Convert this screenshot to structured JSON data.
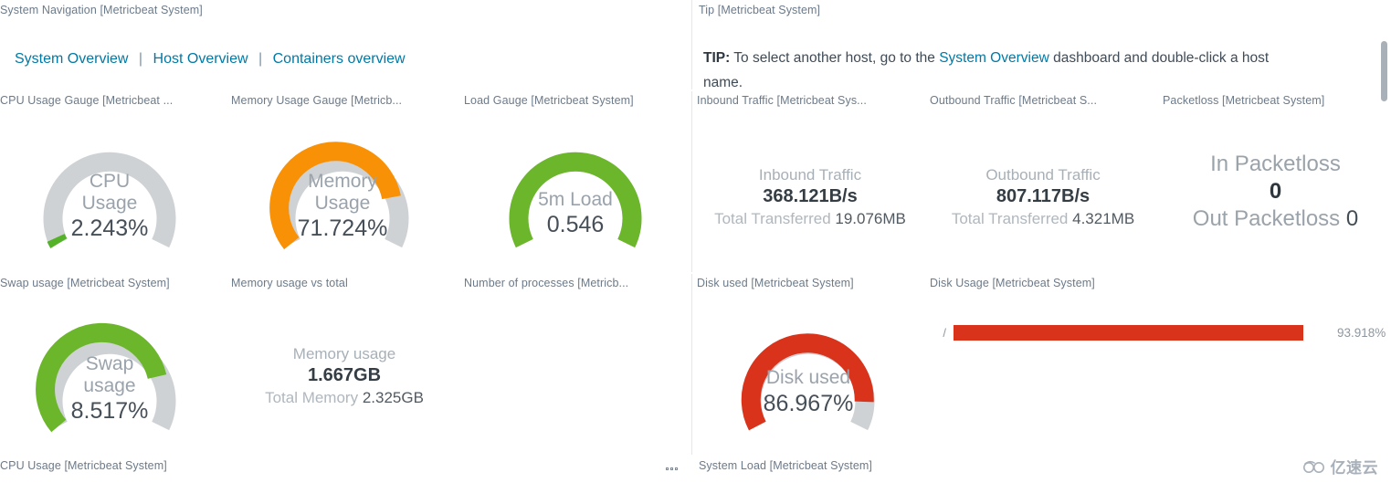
{
  "nav": {
    "panel_title": "System Navigation [Metricbeat System]",
    "links": [
      {
        "label": "System Overview"
      },
      {
        "label": "Host Overview"
      },
      {
        "label": "Containers overview"
      }
    ],
    "separator": "|"
  },
  "tip": {
    "panel_title": "Tip [Metricbeat System]",
    "prefix": "TIP:",
    "text_before": " To select another host, go to the ",
    "link": "System Overview",
    "text_after": " dashboard and double-click a host",
    "clipped_line": "name."
  },
  "row1": {
    "titles": [
      "CPU Usage Gauge [Metricbeat ...",
      "Memory Usage Gauge [Metricb...",
      "Load Gauge [Metricbeat System]",
      "Inbound Traffic [Metricbeat Sys...",
      "Outbound Traffic [Metricbeat S...",
      "Packetloss [Metricbeat System]"
    ]
  },
  "row2": {
    "titles": [
      "Swap usage [Metricbeat System]",
      "Memory usage vs total",
      "Number of processes [Metricb...",
      "Disk used [Metricbeat System]",
      "Disk Usage [Metricbeat System]"
    ]
  },
  "row3": {
    "titles": [
      "CPU Usage [Metricbeat System]",
      "System Load [Metricbeat System]"
    ]
  },
  "gauges": {
    "cpu": {
      "label_line1": "CPU",
      "label_line2": "Usage",
      "value": "2.243%",
      "percent": 2.243,
      "color": "#53b227"
    },
    "memory": {
      "label_line1": "Memory",
      "label_line2": "Usage",
      "value": "71.724%",
      "percent": 71.724,
      "color": "#f99106"
    },
    "load": {
      "label_line1": "5m Load",
      "label_line2": "",
      "value": "0.546",
      "percent": 100,
      "color": "#6cb62b"
    },
    "swap": {
      "label_line1": "Swap",
      "label_line2": "usage",
      "value": "8.517%",
      "percent": 71.0,
      "color": "#6cb62b"
    },
    "disk": {
      "label_line1": "Disk used",
      "label_line2": "",
      "value": "86.967%",
      "percent": 87.0,
      "color": "#d9331b"
    }
  },
  "metrics": {
    "inbound": {
      "title": "Inbound Traffic",
      "value": "368.121B/s",
      "foot_label": "Total Transferred",
      "foot_value": "19.076MB"
    },
    "outbound": {
      "title": "Outbound Traffic",
      "value": "807.117B/s",
      "foot_label": "Total Transferred",
      "foot_value": "4.321MB"
    },
    "memory_total": {
      "title": "Memory usage",
      "value": "1.667GB",
      "foot_label": "Total Memory",
      "foot_value": "2.325GB"
    },
    "packetloss": {
      "in_label": "In Packetloss",
      "in_value": "0",
      "out_label": "Out Packetloss",
      "out_value": "0"
    }
  },
  "disk_usage_bar": {
    "mount": "/",
    "value_label": "93.918%",
    "percent": 93.918,
    "color": "#d9331b"
  },
  "watermark": {
    "text": "亿速云"
  },
  "chart_data": {
    "type": "bar",
    "title": "Disk Usage [Metricbeat System]",
    "categories": [
      "/"
    ],
    "values": [
      93.918
    ],
    "xlabel": "",
    "ylabel": "",
    "xlim": [
      0,
      100
    ],
    "grid": false,
    "legend": "none",
    "gauges": [
      {
        "name": "CPU Usage",
        "value": 2.243,
        "unit": "%",
        "color": "#53b227"
      },
      {
        "name": "Memory Usage",
        "value": 71.724,
        "unit": "%",
        "color": "#f99106"
      },
      {
        "name": "5m Load",
        "value": 0.546,
        "unit": "",
        "color": "#6cb62b"
      },
      {
        "name": "Swap usage",
        "value": 8.517,
        "unit": "%",
        "color": "#6cb62b"
      },
      {
        "name": "Disk used",
        "value": 86.967,
        "unit": "%",
        "color": "#d9331b"
      }
    ],
    "metrics": [
      {
        "name": "Inbound Traffic",
        "value": 368.121,
        "unit": "B/s",
        "total_transferred_mb": 19.076
      },
      {
        "name": "Outbound Traffic",
        "value": 807.117,
        "unit": "B/s",
        "total_transferred_mb": 4.321
      },
      {
        "name": "Memory usage",
        "value": 1.667,
        "unit": "GB",
        "total_memory_gb": 2.325
      },
      {
        "name": "In Packetloss",
        "value": 0,
        "unit": ""
      },
      {
        "name": "Out Packetloss",
        "value": 0,
        "unit": ""
      }
    ]
  }
}
